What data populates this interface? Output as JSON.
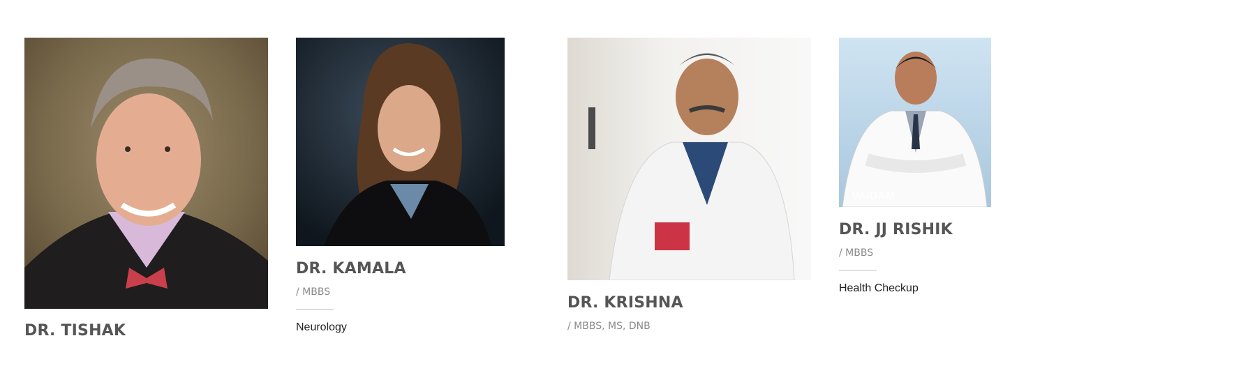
{
  "doctors": [
    {
      "name": "DR. TISHAK",
      "qualifications": "",
      "specialty": ""
    },
    {
      "name": "DR. KAMALA",
      "qualifications": "/ MBBS",
      "specialty": "Neurology"
    },
    {
      "name": "DR. KRISHNA",
      "qualifications": "/ MBBS, MS, DNB",
      "specialty": ""
    },
    {
      "name": "DR. JJ RISHIK",
      "qualifications": "/ MBBS",
      "specialty": "Health Checkup",
      "photo_watermark": "VAIDAM"
    }
  ],
  "colors": {
    "name": "#555555",
    "qualifications": "#8a8a8a",
    "specialty": "#222222",
    "divider": "#bdbdbd"
  }
}
